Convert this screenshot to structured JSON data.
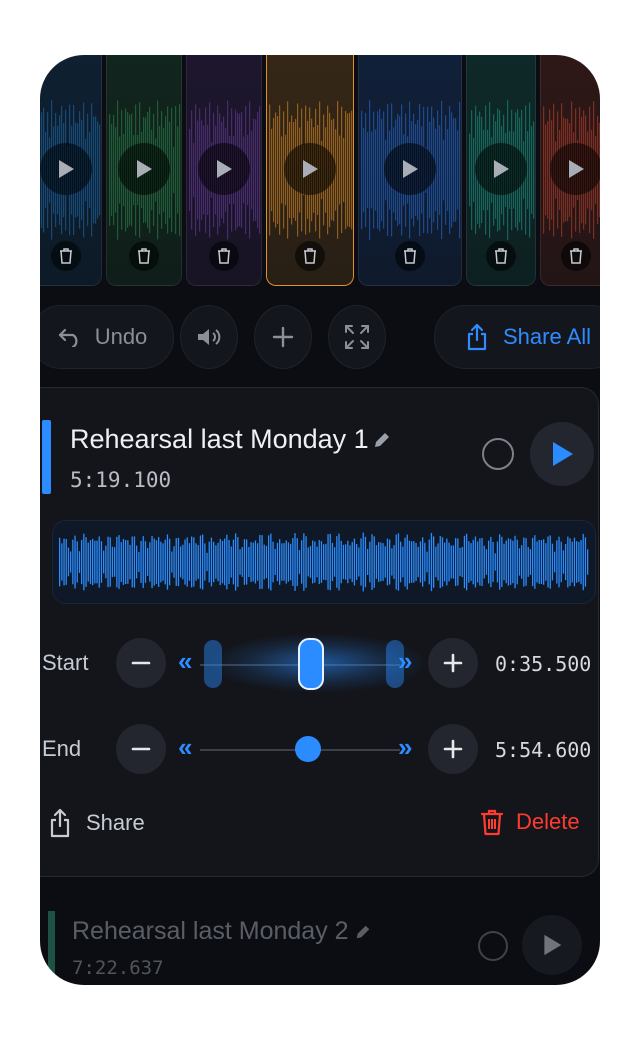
{
  "toolbar": {
    "undo_label": "Undo",
    "share_all_label": "Share All"
  },
  "clips": [
    {
      "color": "#1e6fb0"
    },
    {
      "color": "#2e8b4f"
    },
    {
      "color": "#6b3fa0"
    },
    {
      "color": "#e0902a"
    },
    {
      "color": "#2a6fd6"
    },
    {
      "color": "#1f9b86"
    },
    {
      "color": "#c0462f"
    }
  ],
  "active_recording": {
    "title": "Rehearsal last Monday 1",
    "duration": "5:19.100",
    "start": {
      "label": "Start",
      "value": "0:35.500"
    },
    "end": {
      "label": "End",
      "value": "5:54.600"
    },
    "share_label": "Share",
    "delete_label": "Delete"
  },
  "next_recording": {
    "title": "Rehearsal last Monday 2",
    "duration": "7:22.637"
  },
  "colors": {
    "accent": "#2a8cff",
    "danger": "#ff3b30",
    "background": "#0b0d12"
  }
}
